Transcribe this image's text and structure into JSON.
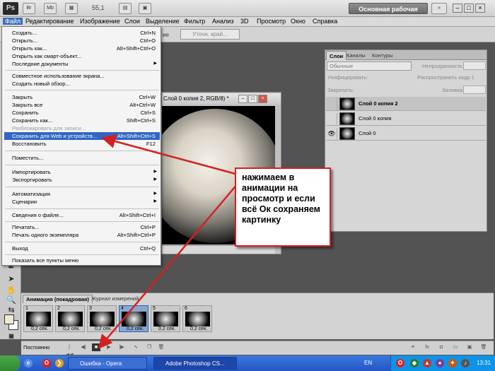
{
  "app": {
    "logo": "Ps",
    "zoom": "55,1",
    "workspace": "Основная рабочая среда"
  },
  "menubar": [
    "Файл",
    "Редактирование",
    "Изображение",
    "Слои",
    "Выделение",
    "Фильтр",
    "Анализ",
    "3D",
    "Просмотр",
    "Окно",
    "Справка"
  ],
  "options": {
    "refine_edge": "Уточн. край...",
    "fragment": "ие"
  },
  "document": {
    "title": "Слой 0 копия 2, RGB/8) *"
  },
  "file_menu": {
    "items": [
      {
        "label": "Создать...",
        "shortcut": "Ctrl+N"
      },
      {
        "label": "Открыть...",
        "shortcut": "Ctrl+O"
      },
      {
        "label": "Открыть как...",
        "shortcut": "Alt+Shift+Ctrl+O"
      },
      {
        "label": "Открыть как смарт-объект...",
        "shortcut": ""
      },
      {
        "label": "Последние документы",
        "shortcut": ""
      },
      {
        "label": "Совместное использование экрана...",
        "shortcut": ""
      },
      {
        "label": "Создать новый обзор...",
        "shortcut": ""
      },
      {
        "label": "Закрыть",
        "shortcut": "Ctrl+W"
      },
      {
        "label": "Закрыть все",
        "shortcut": "Alt+Ctrl+W"
      },
      {
        "label": "Сохранить",
        "shortcut": "Ctrl+S"
      },
      {
        "label": "Сохранить как...",
        "shortcut": "Shift+Ctrl+S"
      },
      {
        "label": "Разблокировать для записи...",
        "shortcut": ""
      },
      {
        "label": "Сохранить для Web и устройств...",
        "shortcut": "Alt+Shift+Ctrl+S"
      },
      {
        "label": "Восстановить",
        "shortcut": "F12"
      },
      {
        "label": "Поместить...",
        "shortcut": ""
      },
      {
        "label": "Импортировать",
        "shortcut": ""
      },
      {
        "label": "Экспортировать",
        "shortcut": ""
      },
      {
        "label": "Автоматизация",
        "shortcut": ""
      },
      {
        "label": "Сценарии",
        "shortcut": ""
      },
      {
        "label": "Сведения о файле...",
        "shortcut": "Alt+Shift+Ctrl+I"
      },
      {
        "label": "Печатать...",
        "shortcut": "Ctrl+P"
      },
      {
        "label": "Печать одного экземпляра",
        "shortcut": "Alt+Shift+Ctrl+P"
      },
      {
        "label": "Выход",
        "shortcut": "Ctrl+Q"
      },
      {
        "label": "Показать все пункты меню",
        "shortcut": ""
      }
    ]
  },
  "layers_panel": {
    "tabs": [
      "Слои",
      "Каналы",
      "Контуры"
    ],
    "blend_mode": "Обычные",
    "opacity_label": "Непрозрачность:",
    "unify_label": "Унифицировать:",
    "propagate_label": "Распространить кадр 1",
    "lock_label": "Закрепить:",
    "fill_label": "Заливка:",
    "layers": [
      {
        "name": "Слой 0 копия 2",
        "eye": ""
      },
      {
        "name": "Слой 0 копия",
        "eye": ""
      },
      {
        "name": "Слой 0",
        "eye": "👁"
      }
    ]
  },
  "animation_panel": {
    "tabs": [
      "Анимация (покадровая)",
      "Журнал измерений"
    ],
    "frames": [
      {
        "num": "1",
        "delay": "0,2 сек."
      },
      {
        "num": "2",
        "delay": "0,2 сек."
      },
      {
        "num": "3",
        "delay": "0,2 сек."
      },
      {
        "num": "4",
        "delay": "0,2 сек."
      },
      {
        "num": "5",
        "delay": "0,2 сек."
      },
      {
        "num": "6",
        "delay": "0,2 сек."
      }
    ],
    "loop": "Постоянно"
  },
  "callout": {
    "text": "нажимаем  в анимации на просмотр и если всё Ок сохраняем картинку"
  },
  "taskbar": {
    "opera_task": "Ошибка - Opera",
    "ps_task": "Adobe Photoshop CS...",
    "lang": "EN",
    "clock": "13:31"
  },
  "colors": {
    "menu_highlight": "#3167c2",
    "callout_border": "#d52020",
    "taskbar": "#2a5fd0"
  }
}
